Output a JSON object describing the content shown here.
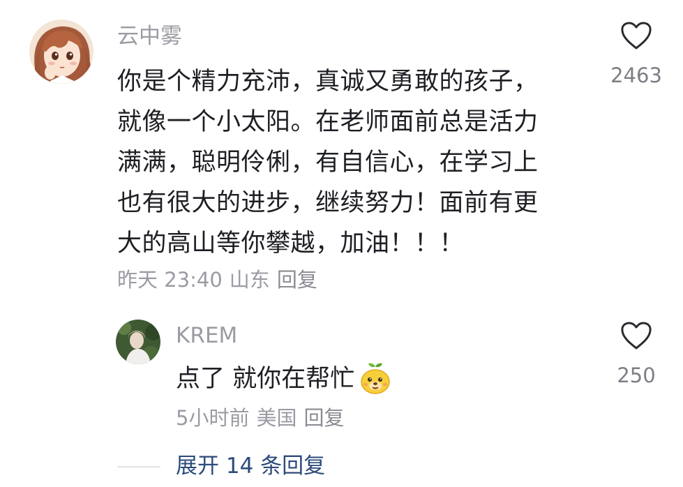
{
  "comment": {
    "username": "云中雾",
    "lines": [
      "你是个精力充沛，真诚又勇敢的孩子，",
      "就像一个小太阳。在老师面前总是活力",
      "满满，聪明伶俐，有自信心，在学习上",
      "也有很大的进步，继续努力！面前有更",
      "大的高山等你攀越，加油！！！"
    ],
    "time": "昨天 23:40",
    "location": "山东",
    "reply_label": "回复",
    "like_count": "2463",
    "like_icon": "heart-outline-icon",
    "avatar": "anime-girl-avatar"
  },
  "reply": {
    "username": "KREM",
    "text": "点了 就你在帮忙",
    "emoji": "dog-face-emoji",
    "time": "5小时前",
    "location": "美国",
    "reply_label": "回复",
    "like_count": "250",
    "like_icon": "heart-outline-icon",
    "avatar": "photo-avatar"
  },
  "expand": {
    "label": "展开 14 条回复"
  },
  "colors": {
    "text_primary": "#1e1f24",
    "text_secondary": "#9a9ba3",
    "link": "#2c4a7a"
  }
}
